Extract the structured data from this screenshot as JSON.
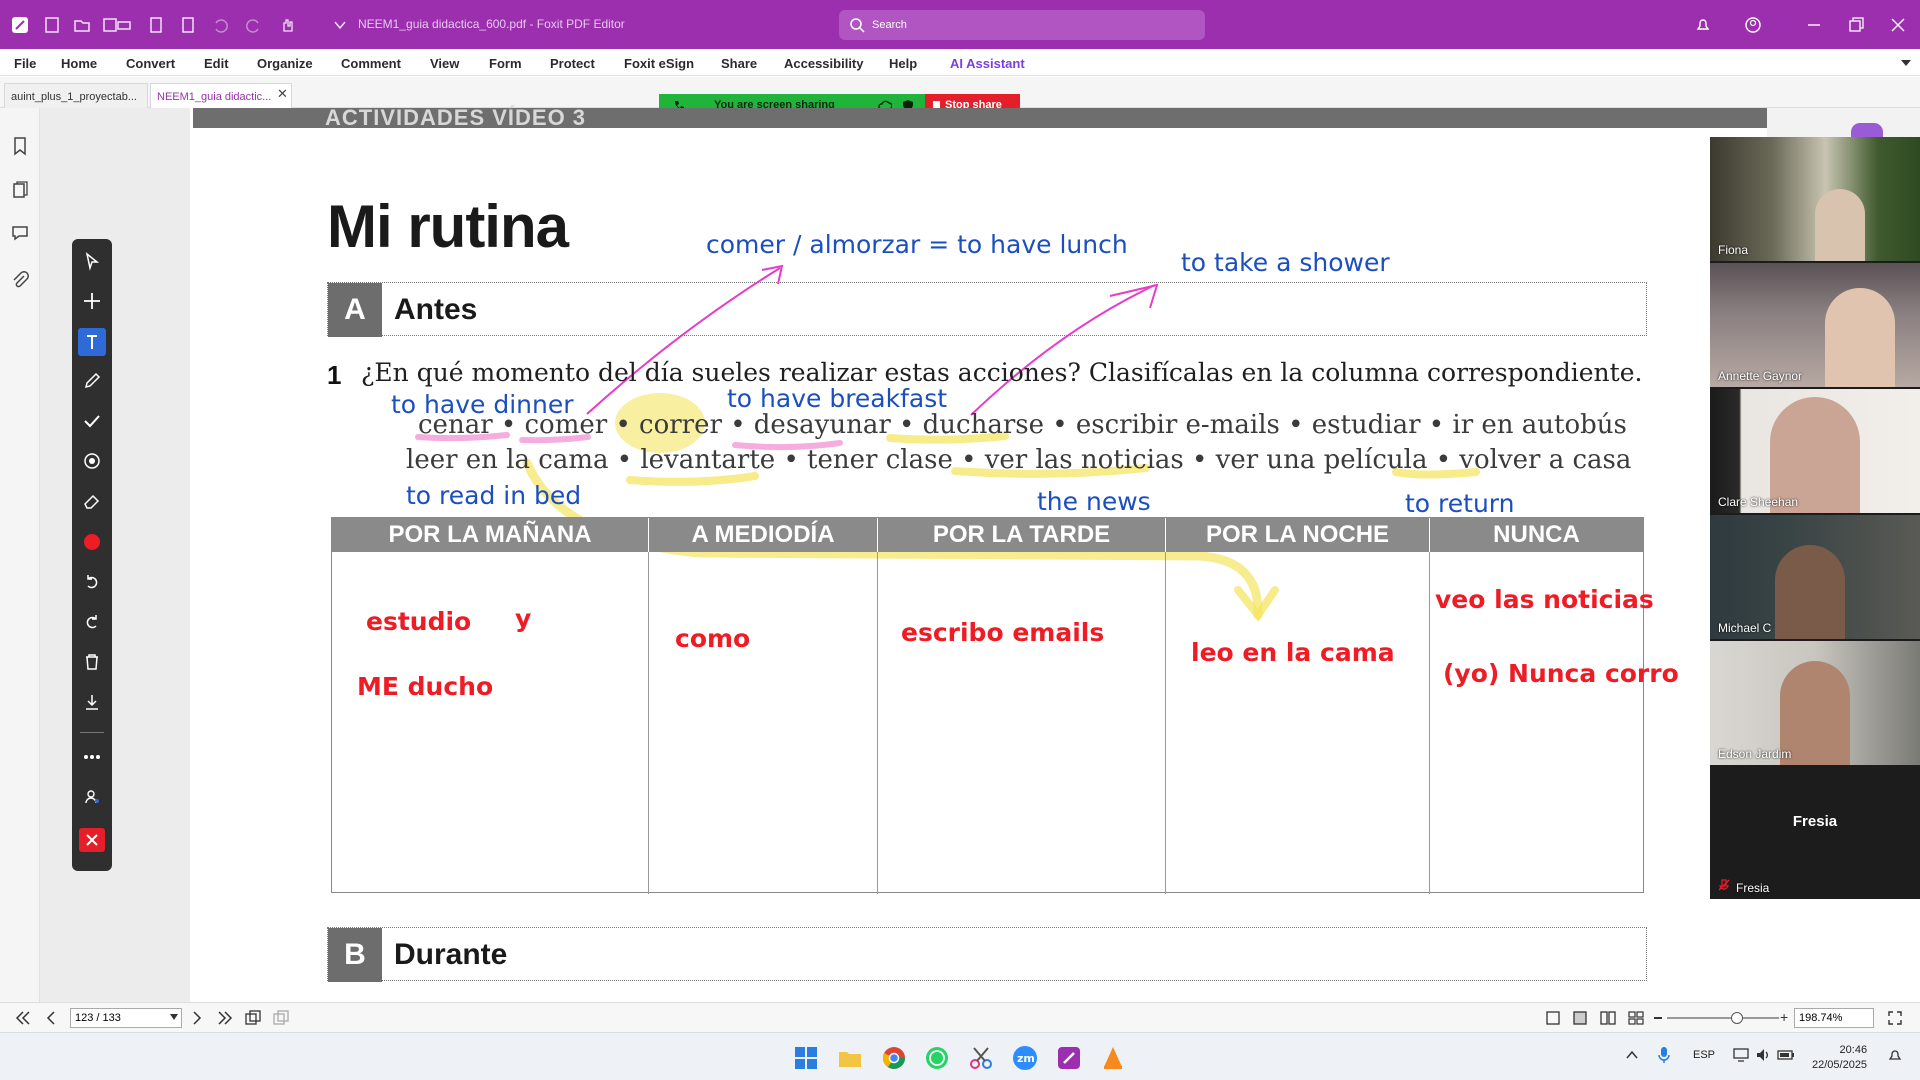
{
  "titlebar": {
    "doc_title": "NEEM1_guia didactica_600.pdf - Foxit PDF Editor",
    "search_placeholder": "Search"
  },
  "menu": [
    "File",
    "Home",
    "Convert",
    "Edit",
    "Organize",
    "Comment",
    "View",
    "Form",
    "Protect",
    "Foxit eSign",
    "Share",
    "Accessibility",
    "Help",
    "AI Assistant"
  ],
  "tabs": [
    {
      "label": "auint_plus_1_proyectab..."
    },
    {
      "label": "NEEM1_guia didactic..."
    }
  ],
  "share": {
    "status": "You are screen sharing",
    "stop": "Stop share"
  },
  "doc": {
    "header_strip": "ACTIVIDADES VÍDEO 3",
    "title": "Mi rutina",
    "section_a": {
      "letter": "A",
      "name": "Antes"
    },
    "section_b": {
      "letter": "B",
      "name": "Durante"
    },
    "q_num": "1",
    "q_text": "¿En qué momento del día sueles realizar estas acciones? Clasifícalas en la columna correspondiente.",
    "line1": "cenar • comer • correr • desayunar • ducharse • escribir e-mails  • estudiar • ir en autobús",
    "line2": "leer en la cama • levantarte • tener clase • ver las noticias • ver una película • volver a casa",
    "notes": {
      "lunch": "comer / almorzar = to have lunch",
      "shower": "to take a shower",
      "dinner": "to have dinner",
      "breakfast": "to have breakfast",
      "read": "to read in bed",
      "news": "the news",
      "return": "to return"
    },
    "table_headers": [
      "POR LA MAÑANA",
      "A MEDIODÍA",
      "POR LA TARDE",
      "POR LA NOCHE",
      "NUNCA"
    ],
    "answers": {
      "estudio": "estudio",
      "y": "y",
      "me_ducho": "ME ducho",
      "como": "como",
      "escribo": "escribo emails",
      "leo": "leo en la cama",
      "veo": "veo las noticias",
      "nunca": "(yo) Nunca corro"
    }
  },
  "status": {
    "page": "123 / 133",
    "zoom": "198.74%"
  },
  "participants": [
    "Fiona",
    "Annette Gaynor",
    "Clare Sheehan",
    "Michael C",
    "Edson Jardim",
    "Fresia"
  ],
  "taskbar": {
    "lang": "ESP",
    "time": "20:46",
    "date": "22/05/2025"
  },
  "colors": {
    "accent": "#9b2fae",
    "note_blue": "#1b4fbf",
    "answer_red": "#ee1c24",
    "highlight_yellow": "#f5e463",
    "highlight_pink": "#f08ad0"
  }
}
